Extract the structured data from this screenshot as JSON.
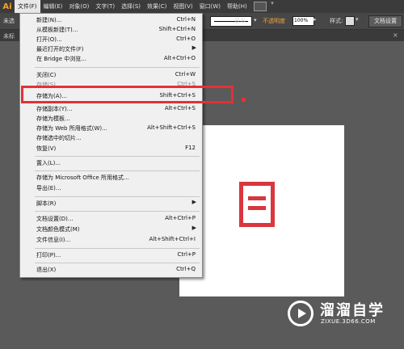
{
  "app": {
    "logo": "Ai"
  },
  "menubar": {
    "items": [
      {
        "label": "文件(F)",
        "active": true
      },
      {
        "label": "编辑(E)"
      },
      {
        "label": "对象(O)"
      },
      {
        "label": "文字(T)"
      },
      {
        "label": "选择(S)"
      },
      {
        "label": "效果(C)"
      },
      {
        "label": "视图(V)"
      },
      {
        "label": "窗口(W)"
      },
      {
        "label": "帮助(H)"
      }
    ],
    "workspace_icon": "layout-icon"
  },
  "control_bar": {
    "left_label": "未选",
    "stroke_label": "基本",
    "opacity_label": "不透明度",
    "opacity_value": "100%",
    "style_label": "样式:",
    "doc_settings_label": "文档设置"
  },
  "tab_bar": {
    "tab_label": "未标",
    "close": "×"
  },
  "file_menu": {
    "items": [
      {
        "label": "新建(N)...",
        "shortcut": "Ctrl+N"
      },
      {
        "label": "从模板新建(T)...",
        "shortcut": "Shift+Ctrl+N"
      },
      {
        "label": "打开(O)...",
        "shortcut": "Ctrl+O"
      },
      {
        "label": "最近打开的文件(F)",
        "submenu": true
      },
      {
        "label": "在 Bridge 中浏览...",
        "shortcut": "Alt+Ctrl+O"
      },
      {
        "label": "关闭(C)",
        "shortcut": "Ctrl+W"
      },
      {
        "label": "存储(S)",
        "shortcut": "Ctrl+S",
        "dim": true
      },
      {
        "label": "存储为(A)...",
        "shortcut": "Shift+Ctrl+S"
      },
      {
        "label": "存储副本(Y)...",
        "shortcut": "Alt+Ctrl+S"
      },
      {
        "label": "存储为模板..."
      },
      {
        "label": "存储为 Web 所用格式(W)...",
        "shortcut": "Alt+Shift+Ctrl+S"
      },
      {
        "label": "存储选中的切片..."
      },
      {
        "label": "恢复(V)",
        "shortcut": "F12"
      },
      {
        "label": "置入(L)..."
      },
      {
        "label": "存储为 Microsoft Office 所用格式..."
      },
      {
        "label": "导出(E)..."
      },
      {
        "label": "脚本(R)",
        "submenu": true
      },
      {
        "label": "文档设置(D)...",
        "shortcut": "Alt+Ctrl+P"
      },
      {
        "label": "文档颜色模式(M)",
        "submenu": true
      },
      {
        "label": "文件信息(I)...",
        "shortcut": "Alt+Shift+Ctrl+I"
      },
      {
        "label": "打印(P)...",
        "shortcut": "Ctrl+P"
      },
      {
        "label": "退出(X)",
        "shortcut": "Ctrl+Q"
      }
    ],
    "submenu_arrow": "▶"
  },
  "highlight": {
    "color": "#e53035",
    "target": "存储为(A)..."
  },
  "artwork": {
    "icon": "document-icon",
    "color": "#d9363e"
  },
  "watermark": {
    "title": "溜溜自学",
    "url": "ZIXUE.3D66.COM"
  }
}
